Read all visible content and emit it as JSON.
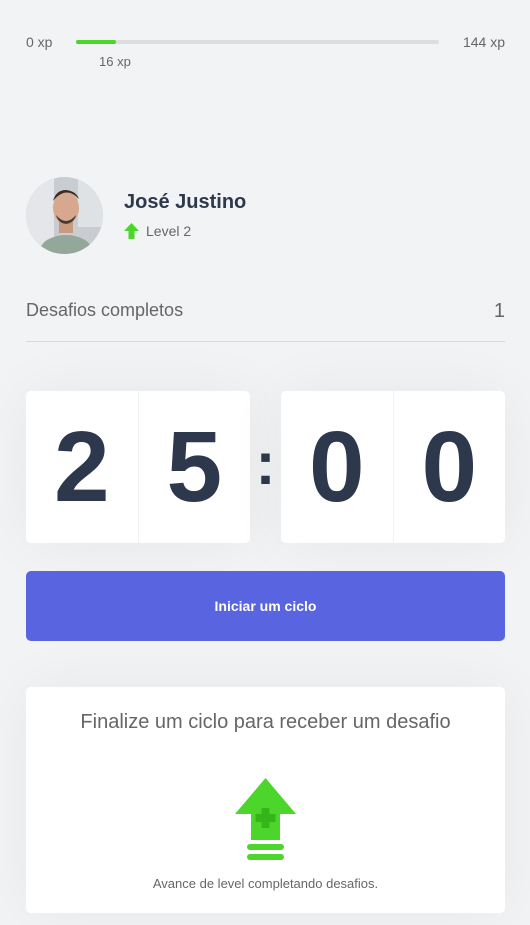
{
  "xp": {
    "min_label": "0 xp",
    "max_label": "144 xp",
    "current_label": "16 xp",
    "progress_fraction": 0.11,
    "accent_color": "#4cd62b"
  },
  "profile": {
    "name": "José Justino",
    "level_label": "Level 2",
    "level_icon": "level-up-arrow-icon"
  },
  "challenges": {
    "label": "Desafios completos",
    "count": "1"
  },
  "countdown": {
    "minute_left": "2",
    "minute_right": "5",
    "separator": ":",
    "second_left": "0",
    "second_right": "0"
  },
  "start_button": {
    "label": "Iniciar um ciclo",
    "color": "#5965e0"
  },
  "challenge_box": {
    "title": "Finalize um ciclo para receber um desafio",
    "icon": "level-up-icon",
    "hint": "Avance de level completando desafios."
  }
}
